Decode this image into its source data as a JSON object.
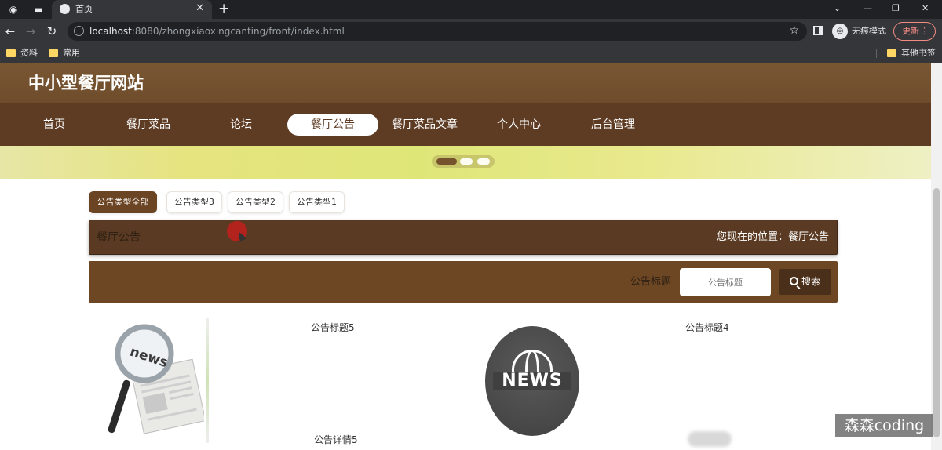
{
  "browser": {
    "tab_title": "首页",
    "url_host": "localhost",
    "url_rest": ":8080/zhongxiaoxingcanting/front/index.html",
    "incognito_label": "无痕模式",
    "update_label": "更新",
    "bookmarks": [
      "资料",
      "常用"
    ],
    "other_bookmarks": "其他书签"
  },
  "site": {
    "title": "中小型餐厅网站",
    "nav": [
      "首页",
      "餐厅菜品",
      "论坛",
      "餐厅公告",
      "餐厅菜品文章",
      "个人中心",
      "后台管理"
    ],
    "active_nav": "餐厅公告"
  },
  "filters": [
    "公告类型全部",
    "公告类型3",
    "公告类型2",
    "公告类型1"
  ],
  "breadcrumb": {
    "title": "餐厅公告",
    "location": "您现在的位置：餐厅公告"
  },
  "search": {
    "label": "公告标题",
    "placeholder": "公告标题",
    "button": "搜索"
  },
  "posts": [
    {
      "title": "公告标题5",
      "detail": "公告详情5",
      "image": "news-magnifier-icon"
    },
    {
      "title": "公告标题4",
      "image": "news-globe-icon"
    }
  ],
  "news_badge_text": "NEWS",
  "news_paper_text": "news",
  "watermark": "森森coding",
  "colors": {
    "header": "#7a5733",
    "nav": "#5e3b23",
    "accent": "#6b4424"
  }
}
